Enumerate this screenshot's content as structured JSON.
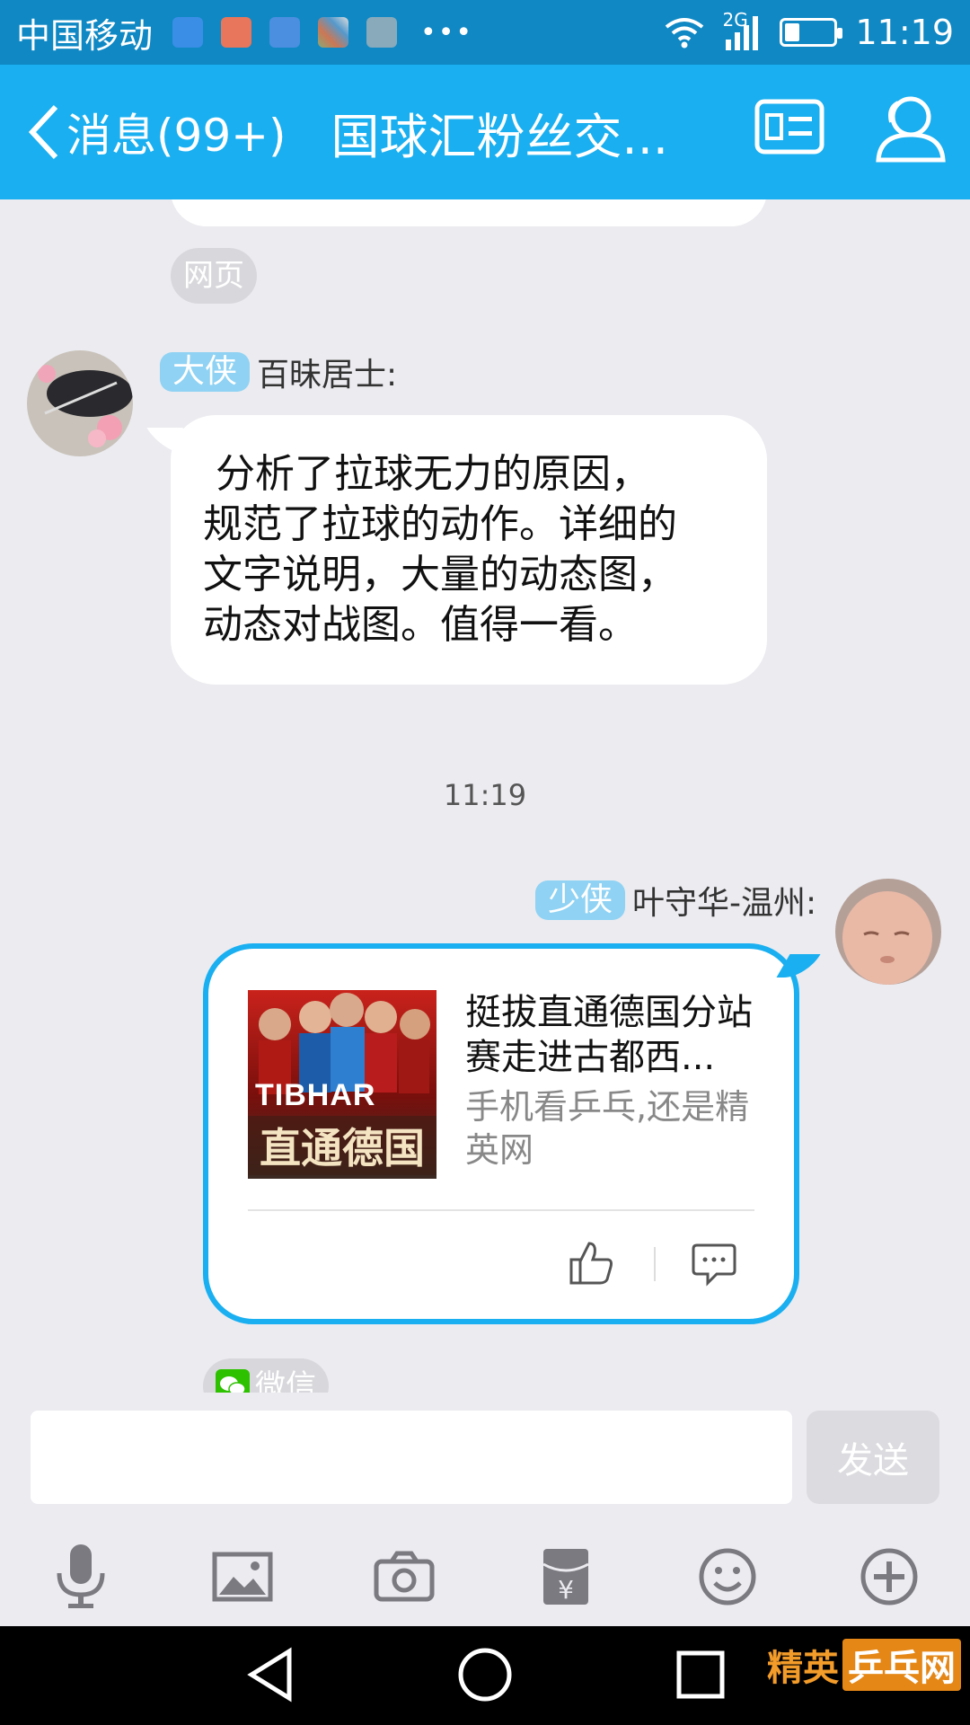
{
  "status_bar": {
    "carrier": "中国移动",
    "network": "2G",
    "time": "11:19",
    "battery_level": 0.3,
    "notification_icons": [
      "mail-app-icon",
      "inbox-icon",
      "health-icon",
      "gallery-icon",
      "image-icon"
    ]
  },
  "header": {
    "back_label": "消息(99+)",
    "title": "国球汇粉丝交...",
    "profile_card_icon": "id-card-icon",
    "members_icon": "group-icon"
  },
  "messages": {
    "source1": "网页",
    "sender1": {
      "rank": "大侠",
      "name": "百昧居士:"
    },
    "text1": " 分析了拉球无力的原因，\n规范了拉球的动作。详细的\n文字说明，大量的动态图，\n动态对战图。值得一看。",
    "timestamp": "11:19",
    "sender2": {
      "rank": "少侠",
      "name": "叶守华-温州:"
    },
    "card": {
      "thumb_brand": "TIBHAR",
      "thumb_caption": "直通德国",
      "title": "挺拔直通德国分站赛走进古都西...",
      "desc": "手机看乒乓,还是精英网"
    },
    "source2": "微信"
  },
  "input": {
    "placeholder": "",
    "send_label": "发送"
  },
  "toolbar": [
    "microphone-icon",
    "image-icon",
    "camera-icon",
    "red-packet-icon",
    "emoji-icon",
    "plus-icon"
  ],
  "watermark": {
    "text1": "精英",
    "text2": "乒乓网"
  },
  "colors": {
    "header": "#19aff0",
    "status_bar": "#0f88c4",
    "rank_badge": "#8fd2f3",
    "background": "#ebebf0"
  }
}
